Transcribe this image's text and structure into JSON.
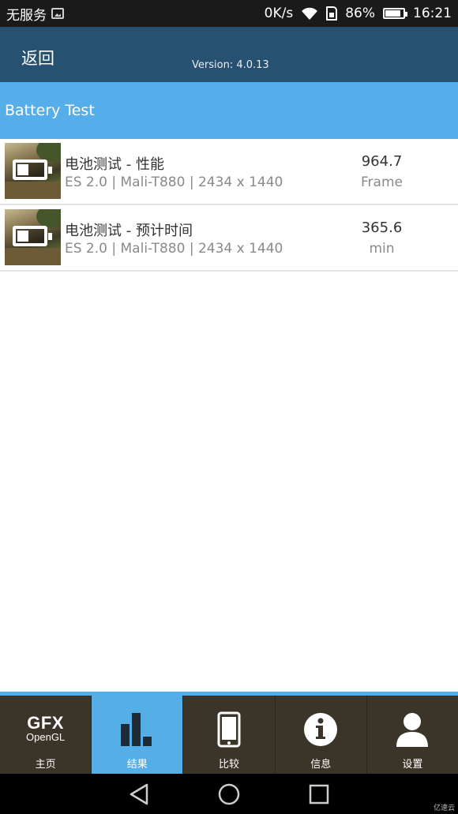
{
  "status_bar": {
    "carrier": "无服务",
    "network_speed": "0K/s",
    "battery_percent": "86%",
    "time": "16:21"
  },
  "header": {
    "back_label": "返回",
    "version": "Version: 4.0.13"
  },
  "section": {
    "title": "Battery Test"
  },
  "results": [
    {
      "title": "电池测试 - 性能",
      "subtitle": "ES 2.0 | Mali-T880 | 2434 x 1440",
      "value": "964.7",
      "unit": "Frame"
    },
    {
      "title": "电池测试 - 预计时间",
      "subtitle": "ES 2.0 | Mali-T880 | 2434 x 1440",
      "value": "365.6",
      "unit": "min"
    }
  ],
  "tabs": [
    {
      "label": "主页",
      "icon": "gfx-opengl-logo",
      "logo_big": "GFX",
      "logo_small": "OpenGL",
      "active": false
    },
    {
      "label": "结果",
      "icon": "bar-chart-icon",
      "active": true
    },
    {
      "label": "比较",
      "icon": "phone-icon",
      "active": false
    },
    {
      "label": "信息",
      "icon": "info-icon",
      "active": false
    },
    {
      "label": "设置",
      "icon": "user-icon",
      "active": false
    }
  ],
  "colors": {
    "header_bg": "#265171",
    "accent_blue": "#55aee9",
    "tabbar_bg": "#3b3429"
  },
  "watermark": "亿速云"
}
